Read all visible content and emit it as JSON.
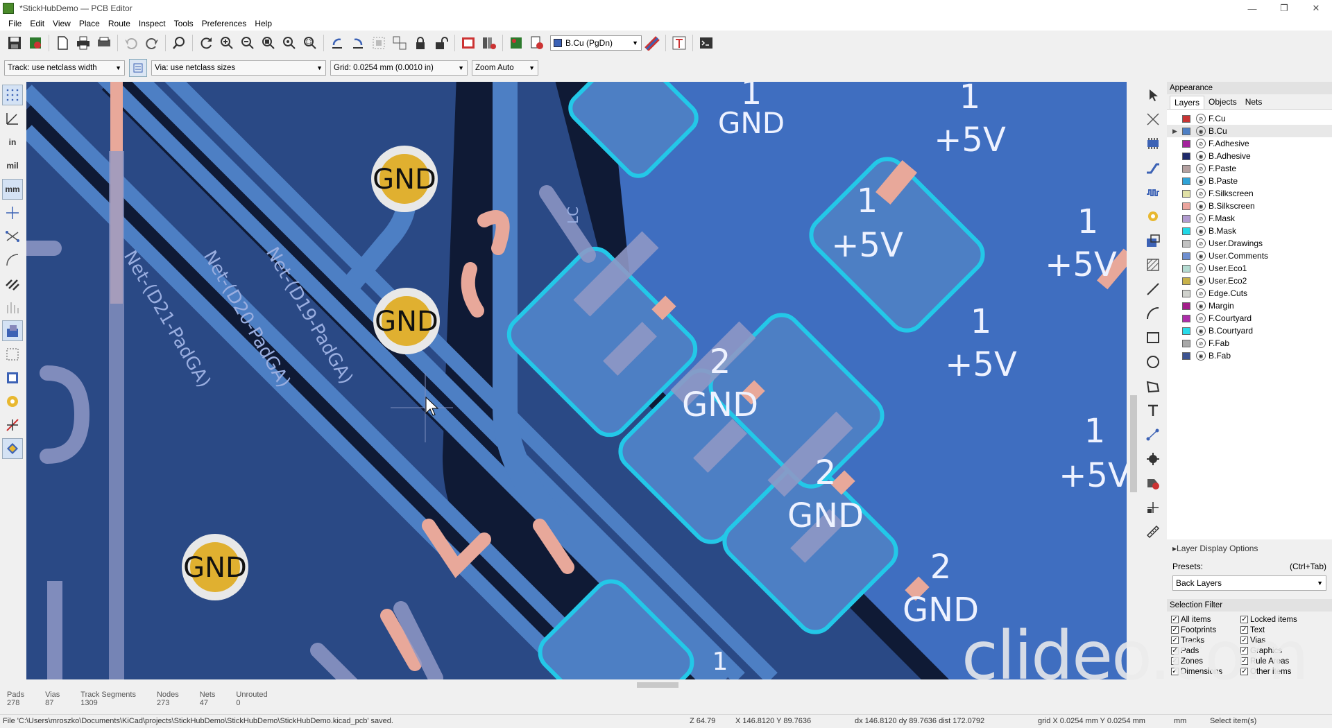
{
  "window": {
    "title": "*StickHubDemo — PCB Editor",
    "minimize": "—",
    "restore": "❐",
    "close": "✕"
  },
  "menu": [
    "File",
    "Edit",
    "View",
    "Place",
    "Route",
    "Inspect",
    "Tools",
    "Preferences",
    "Help"
  ],
  "toolbar": {
    "active_layer": "B.Cu (PgDn)"
  },
  "aux": {
    "track": "Track: use netclass width",
    "via": "Via: use netclass sizes",
    "grid": "Grid: 0.0254 mm (0.0010 in)",
    "zoom": "Zoom Auto"
  },
  "left_toolbar": {
    "in_label": "in",
    "mil_label": "mil",
    "mm_label": "mm"
  },
  "canvas": {
    "gnd_via_label": "GND",
    "net_labels": [
      "Net-(D21-PadGA)",
      "Net-(D20-PadGA)",
      "Net-(D19-PadGA)"
    ],
    "silk_lc": "LC",
    "pads": [
      {
        "num": "1",
        "net": "GND"
      },
      {
        "num": "1",
        "net": "+5V"
      },
      {
        "num": "1",
        "net": "+5V"
      },
      {
        "num": "1",
        "net": "+5V"
      },
      {
        "num": "1",
        "net": "+5V"
      },
      {
        "num": "1",
        "net": "+5V"
      },
      {
        "num": "2",
        "net": "GND"
      },
      {
        "num": "2",
        "net": "GND"
      },
      {
        "num": "2",
        "net": "GND"
      },
      {
        "num": "1",
        "net": ""
      }
    ]
  },
  "appearance": {
    "title": "Appearance",
    "tabs": [
      "Layers",
      "Objects",
      "Nets"
    ],
    "layers": [
      {
        "name": "F.Cu",
        "color": "#c83434"
      },
      {
        "name": "B.Cu",
        "color": "#4d7fc4"
      },
      {
        "name": "F.Adhesive",
        "color": "#a3239c"
      },
      {
        "name": "B.Adhesive",
        "color": "#1f2a6b"
      },
      {
        "name": "F.Paste",
        "color": "#b4a0a0"
      },
      {
        "name": "B.Paste",
        "color": "#2fa3d7"
      },
      {
        "name": "F.Silkscreen",
        "color": "#e1e1a6"
      },
      {
        "name": "B.Silkscreen",
        "color": "#eba59e"
      },
      {
        "name": "F.Mask",
        "color": "#b19bd0"
      },
      {
        "name": "B.Mask",
        "color": "#21d8e6"
      },
      {
        "name": "User.Drawings",
        "color": "#c2c2c2"
      },
      {
        "name": "User.Comments",
        "color": "#6f8fd0"
      },
      {
        "name": "User.Eco1",
        "color": "#b4dbd2"
      },
      {
        "name": "User.Eco2",
        "color": "#c8b24a"
      },
      {
        "name": "Edge.Cuts",
        "color": "#d0d2cd"
      },
      {
        "name": "Margin",
        "color": "#a31e8a"
      },
      {
        "name": "F.Courtyard",
        "color": "#ad2eaa"
      },
      {
        "name": "B.Courtyard",
        "color": "#27dbe9"
      },
      {
        "name": "F.Fab",
        "color": "#a8a8a8"
      },
      {
        "name": "B.Fab",
        "color": "#3d5491"
      }
    ],
    "layer_display_options": "Layer Display Options",
    "presets_label": "Presets:",
    "presets_shortcut": "(Ctrl+Tab)",
    "preset_value": "Back Layers",
    "selection_filter": "Selection Filter",
    "filters": [
      "All items",
      "Locked items",
      "Footprints",
      "Text",
      "Tracks",
      "Vias",
      "Pads",
      "Graphics",
      "Zones",
      "Rule Areas",
      "Dimensions",
      "Other items"
    ]
  },
  "stats": [
    {
      "label": "Pads",
      "value": "278"
    },
    {
      "label": "Vias",
      "value": "87"
    },
    {
      "label": "Track Segments",
      "value": "1309"
    },
    {
      "label": "Nodes",
      "value": "273"
    },
    {
      "label": "Nets",
      "value": "47"
    },
    {
      "label": "Unrouted",
      "value": "0"
    }
  ],
  "status": {
    "message": "File 'C:\\Users\\mroszko\\Documents\\KiCad\\projects\\StickHubDemo\\StickHubDemo\\StickHubDemo.kicad_pcb' saved.",
    "zoom": "Z 64.79",
    "coords": "X 146.8120  Y 89.7636",
    "delta": "dx 146.8120  dy 89.7636  dist 172.0792",
    "grid": "grid X 0.0254 mm  Y 0.0254 mm",
    "units": "mm",
    "mode": "Select item(s)"
  },
  "watermark": "clideo.com"
}
